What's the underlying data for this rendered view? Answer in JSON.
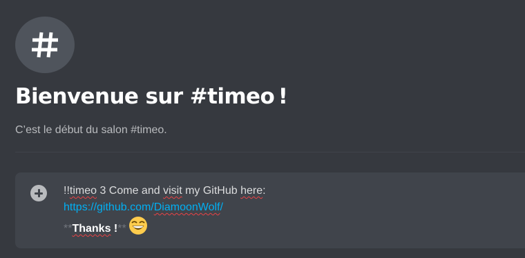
{
  "channel": {
    "icon": "hash-icon",
    "welcome_title": "Bienvenue sur #timeo !",
    "welcome_subtitle": "C’est le début du salon #timeo."
  },
  "composer": {
    "attach_icon": "plus-circle-icon",
    "line1": {
      "prefix": "!!",
      "word_timeo": "timeo",
      "sep1": " 3 Come and ",
      "word_visit": "visit",
      "sep2": " my GitHub ",
      "word_here": "here",
      "suffix": ":"
    },
    "line2": {
      "url_prefix": "https://github.com/",
      "url_word": "DiamoonWolf",
      "url_suffix": "/"
    },
    "line3": {
      "open_syntax": "**",
      "bold_word": "Thanks",
      "bold_tail": " !",
      "close_syntax": "**",
      "emoji": "grinning-face-emoji"
    }
  },
  "colors": {
    "background": "#36393f",
    "composer": "#40444b",
    "link": "#00b0f4",
    "spellcheck": "#ed4245"
  }
}
